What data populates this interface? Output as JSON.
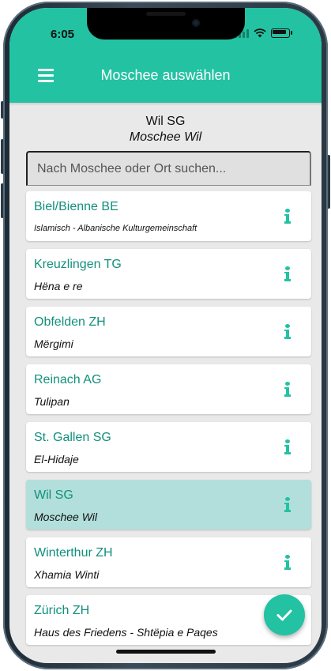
{
  "status_bar": {
    "time": "6:05"
  },
  "app_bar": {
    "title": "Moschee auswählen"
  },
  "selected": {
    "city": "Wil SG",
    "mosque": "Moschee Wil"
  },
  "search": {
    "placeholder": "Nach Moschee oder Ort suchen..."
  },
  "mosques": [
    {
      "city": "Biel/Bienne BE",
      "name": "Islamisch - Albanische Kulturgemeinschaft",
      "selected": false
    },
    {
      "city": "Kreuzlingen TG",
      "name": "Hëna e re",
      "selected": false
    },
    {
      "city": "Obfelden ZH",
      "name": "Mërgimi",
      "selected": false
    },
    {
      "city": "Reinach AG",
      "name": "Tulipan",
      "selected": false
    },
    {
      "city": "St. Gallen SG",
      "name": "El-Hidaje",
      "selected": false
    },
    {
      "city": "Wil SG",
      "name": "Moschee Wil",
      "selected": true
    },
    {
      "city": "Winterthur ZH",
      "name": "Xhamia Winti",
      "selected": false
    },
    {
      "city": "Zürich ZH",
      "name": "Haus des Friedens - Shtëpia e Paqes",
      "selected": false
    }
  ],
  "colors": {
    "primary": "#22c2a2",
    "accent_text": "#11907c",
    "selected_row": "#b2dfdb",
    "background": "#e9e9e9"
  },
  "icons": {
    "menu": "hamburger-menu-icon",
    "info": "info-icon",
    "confirm": "checkmark-icon"
  }
}
